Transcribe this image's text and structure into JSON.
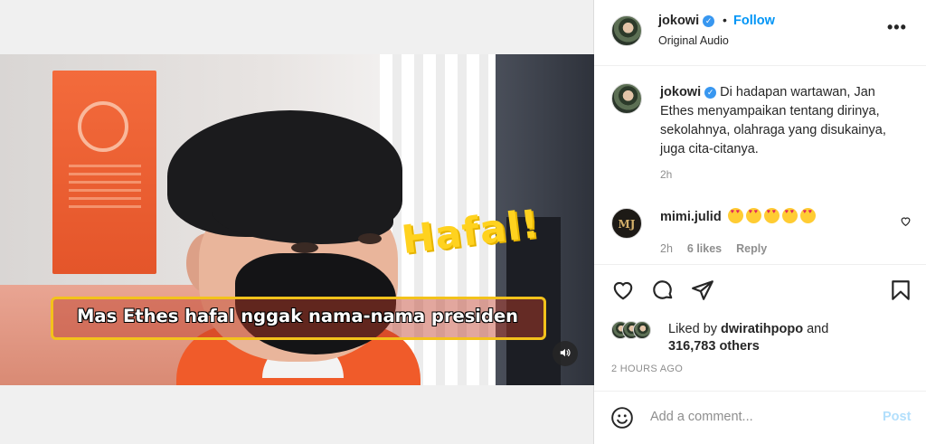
{
  "post": {
    "video": {
      "overlay_title": "Hafal!",
      "subtitle": "Mas Ethes hafal nggak nama-nama presiden",
      "mute_icon": "speaker-icon"
    },
    "header": {
      "username": "jokowi",
      "verified_icon": "verified-badge-icon",
      "separator": "•",
      "follow_label": "Follow",
      "audio_label": "Original Audio",
      "more_icon": "more-options-icon",
      "more_label": "•••"
    },
    "caption": {
      "username": "jokowi",
      "text": "Di hadapan wartawan, Jan Ethes menyampaikan tentang dirinya, sekolahnya, olahraga yang disukainya, juga cita-citanya.",
      "time": "2h"
    },
    "comments": [
      {
        "avatar_initials": "MJ",
        "username": "mimi.julid",
        "emoji_count": 5,
        "emoji_name": "heart-eyes-emoji",
        "time": "2h",
        "likes": "6 likes",
        "reply_label": "Reply"
      }
    ],
    "actions": {
      "like_icon": "heart-icon",
      "comment_icon": "comment-icon",
      "share_icon": "share-icon",
      "save_icon": "bookmark-icon"
    },
    "likes": {
      "prefix": "Liked by",
      "user": "dwiratihpopo",
      "and": "and",
      "others": "316,783 others"
    },
    "timestamp": "2 HOURS AGO",
    "comment_input": {
      "emoji_icon": "smiley-icon",
      "placeholder": "Add a comment...",
      "post_label": "Post"
    }
  },
  "colors": {
    "accent": "#0095f6",
    "post_disabled": "#b2dffc",
    "verified": "#3897f0",
    "hafal_yellow": "#ffd21f"
  }
}
